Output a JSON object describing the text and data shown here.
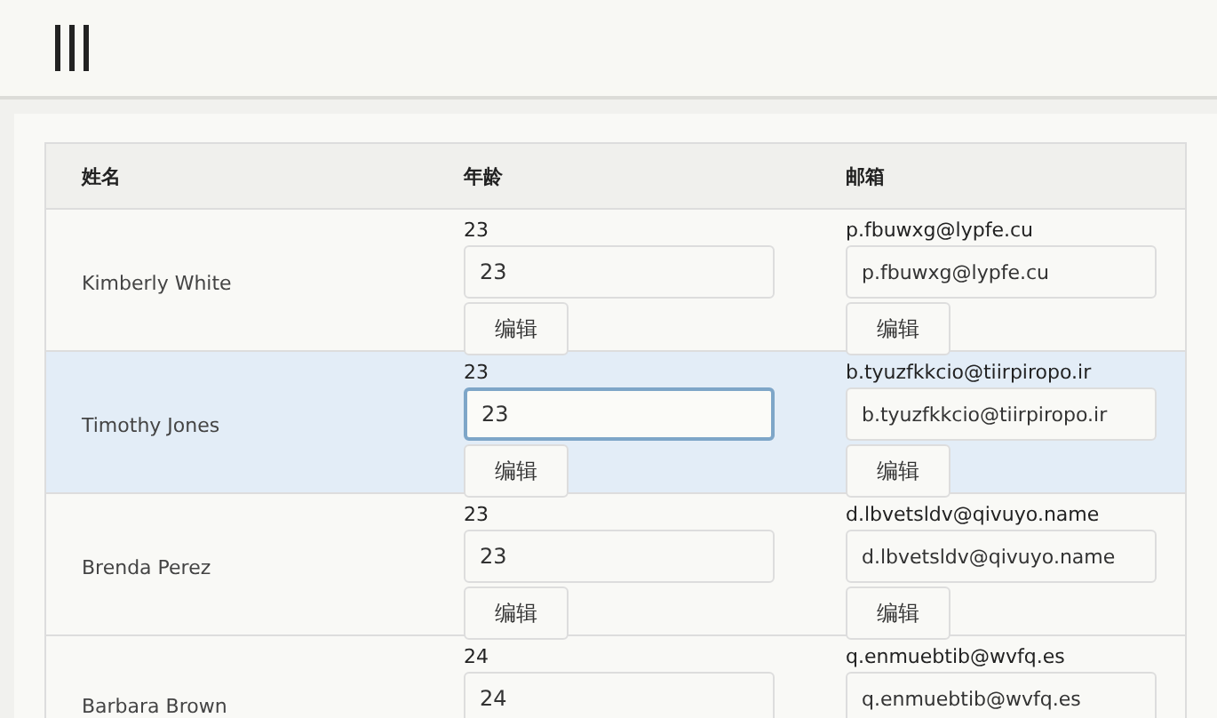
{
  "table": {
    "columns": [
      "姓名",
      "年龄",
      "邮箱"
    ],
    "rows": [
      {
        "name": "Kimberly White",
        "age": "23",
        "age_value": "23",
        "email": "p.fbuwxg@lypfe.cu",
        "email_value": "p.fbuwxg@lypfe.cu",
        "age_button": "编辑",
        "email_button": "编辑",
        "selected": false
      },
      {
        "name": "Timothy Jones",
        "age": "23",
        "age_value": "23",
        "email": "b.tyuzfkkcio@tiirpiropo.ir",
        "email_value": "b.tyuzfkkcio@tiirpiropo.ir",
        "age_button": "编辑",
        "email_button": "编辑",
        "selected": true
      },
      {
        "name": "Brenda Perez",
        "age": "23",
        "age_value": "23",
        "email": "d.lbvetsldv@qivuyo.name",
        "email_value": "d.lbvetsldv@qivuyo.name",
        "age_button": "编辑",
        "email_button": "编辑",
        "selected": false
      },
      {
        "name": "Barbara Brown",
        "age": "24",
        "age_value": "24",
        "email": "q.enmuebtib@wvfq.es",
        "email_value": "q.enmuebtib@wvfq.es",
        "selected": false
      }
    ]
  }
}
